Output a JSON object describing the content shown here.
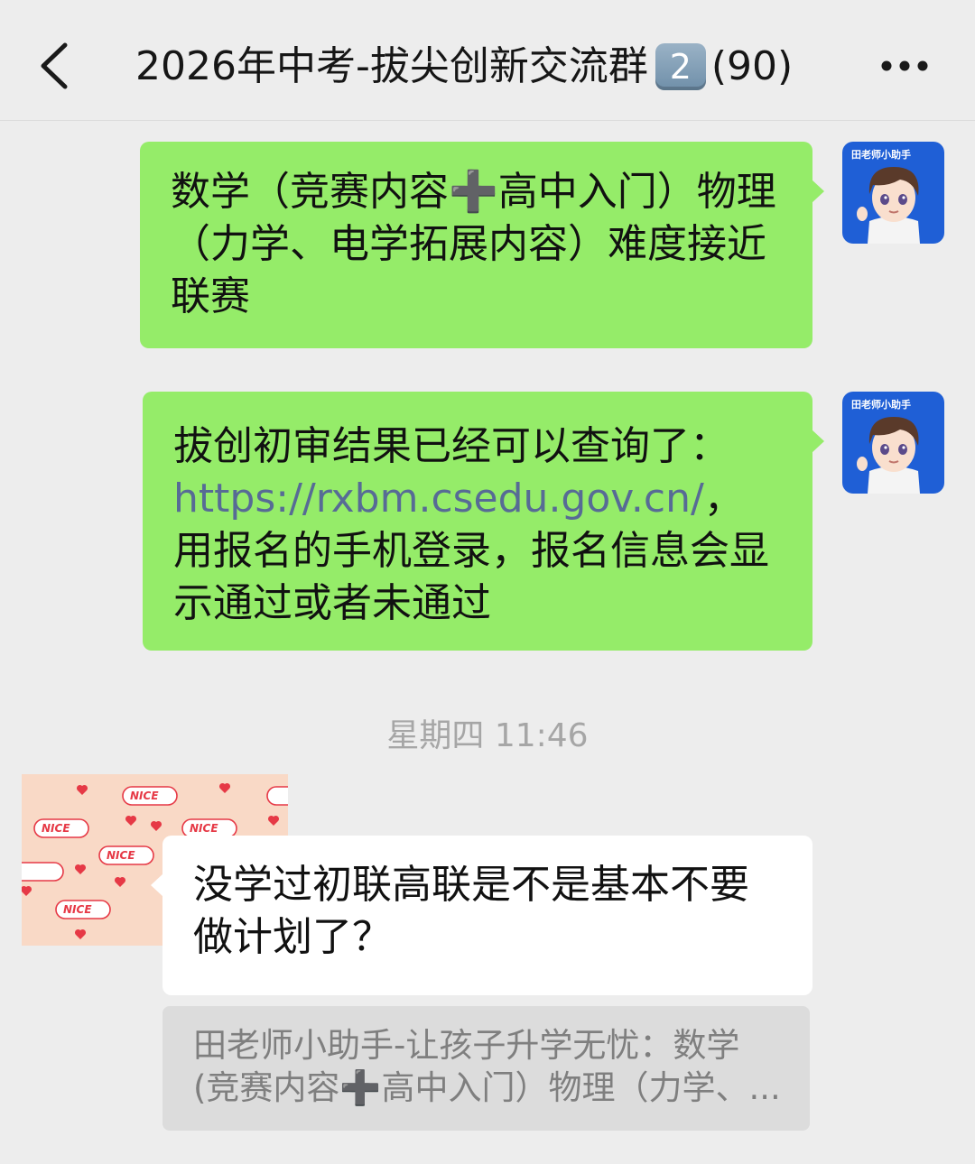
{
  "header": {
    "title_prefix": "2026年中考-拔尖创新交流群",
    "title_keycap": "2",
    "title_count": "(90)"
  },
  "messages": [
    {
      "sender": "self",
      "avatar_label": "田老师小助手",
      "text": "数学（竞赛内容➕高中入门）物理（力学、电学拓展内容）难度接近联赛"
    },
    {
      "sender": "self",
      "avatar_label": "田老师小助手",
      "text_before": "拔创初审结果已经可以查询了：",
      "link": "https://rxbm.csedu.gov.cn/",
      "text_after": "，用报名的手机登录，报名信息会显示通过或者未通过"
    }
  ],
  "timestamp": "星期四 11:46",
  "incoming": {
    "avatar_sticker_text": "NICE",
    "text": "没学过初联高联是不是基本不要做计划了？",
    "quote_line1": "田老师小助手-让孩子升学无忧：数学",
    "quote_line2": "(竞赛内容➕高中入门）物理（力学、..."
  },
  "icons": {
    "back": "chevron-left-icon",
    "more": "more-dots-icon"
  },
  "colors": {
    "self_bubble": "#95ec69",
    "other_bubble": "#ffffff",
    "link": "#576b95",
    "background": "#ededed",
    "avatar_bg": "#1f5fd6"
  }
}
